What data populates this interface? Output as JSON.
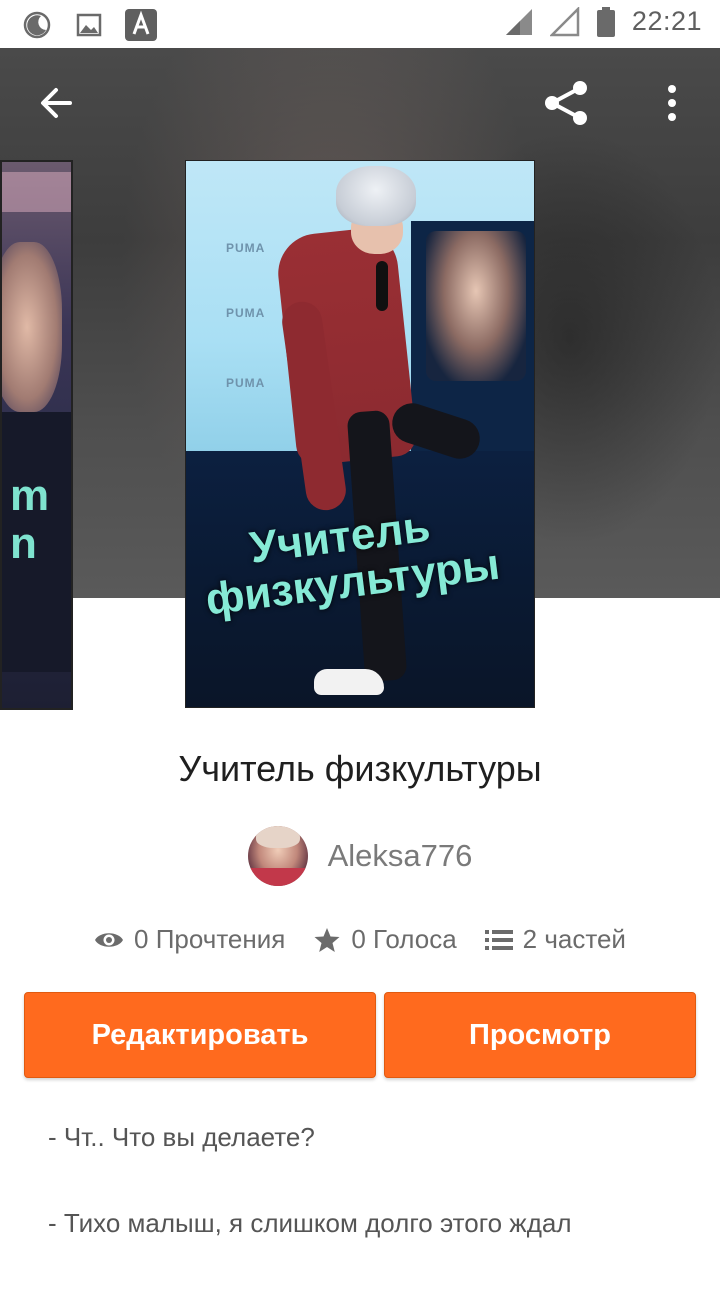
{
  "status_bar": {
    "time": "22:21",
    "icons": [
      "moon-icon",
      "image-icon",
      "text-a-icon",
      "signal-icon",
      "signal-empty-icon",
      "battery-icon"
    ]
  },
  "top_bar": {
    "back_icon": "arrow-left-icon",
    "share_icon": "share-icon",
    "more_icon": "more-vertical-icon"
  },
  "cover": {
    "title_line1": "Учитель",
    "title_line2": "физкультуры",
    "brand_text": "PUMA"
  },
  "story": {
    "title": "Учитель физкультуры",
    "author": "Aleksa776"
  },
  "stats": {
    "reads": "0 Прочтения",
    "votes": "0 Голоса",
    "parts": "2 частей"
  },
  "buttons": {
    "edit": "Редактировать",
    "view": "Просмотр"
  },
  "description": [
    "- Чт.. Что вы делаете?",
    "- Тихо малыш, я слишком долго этого ждал"
  ],
  "colors": {
    "accent": "#ff6a1e",
    "cover_text": "#86ead6"
  }
}
